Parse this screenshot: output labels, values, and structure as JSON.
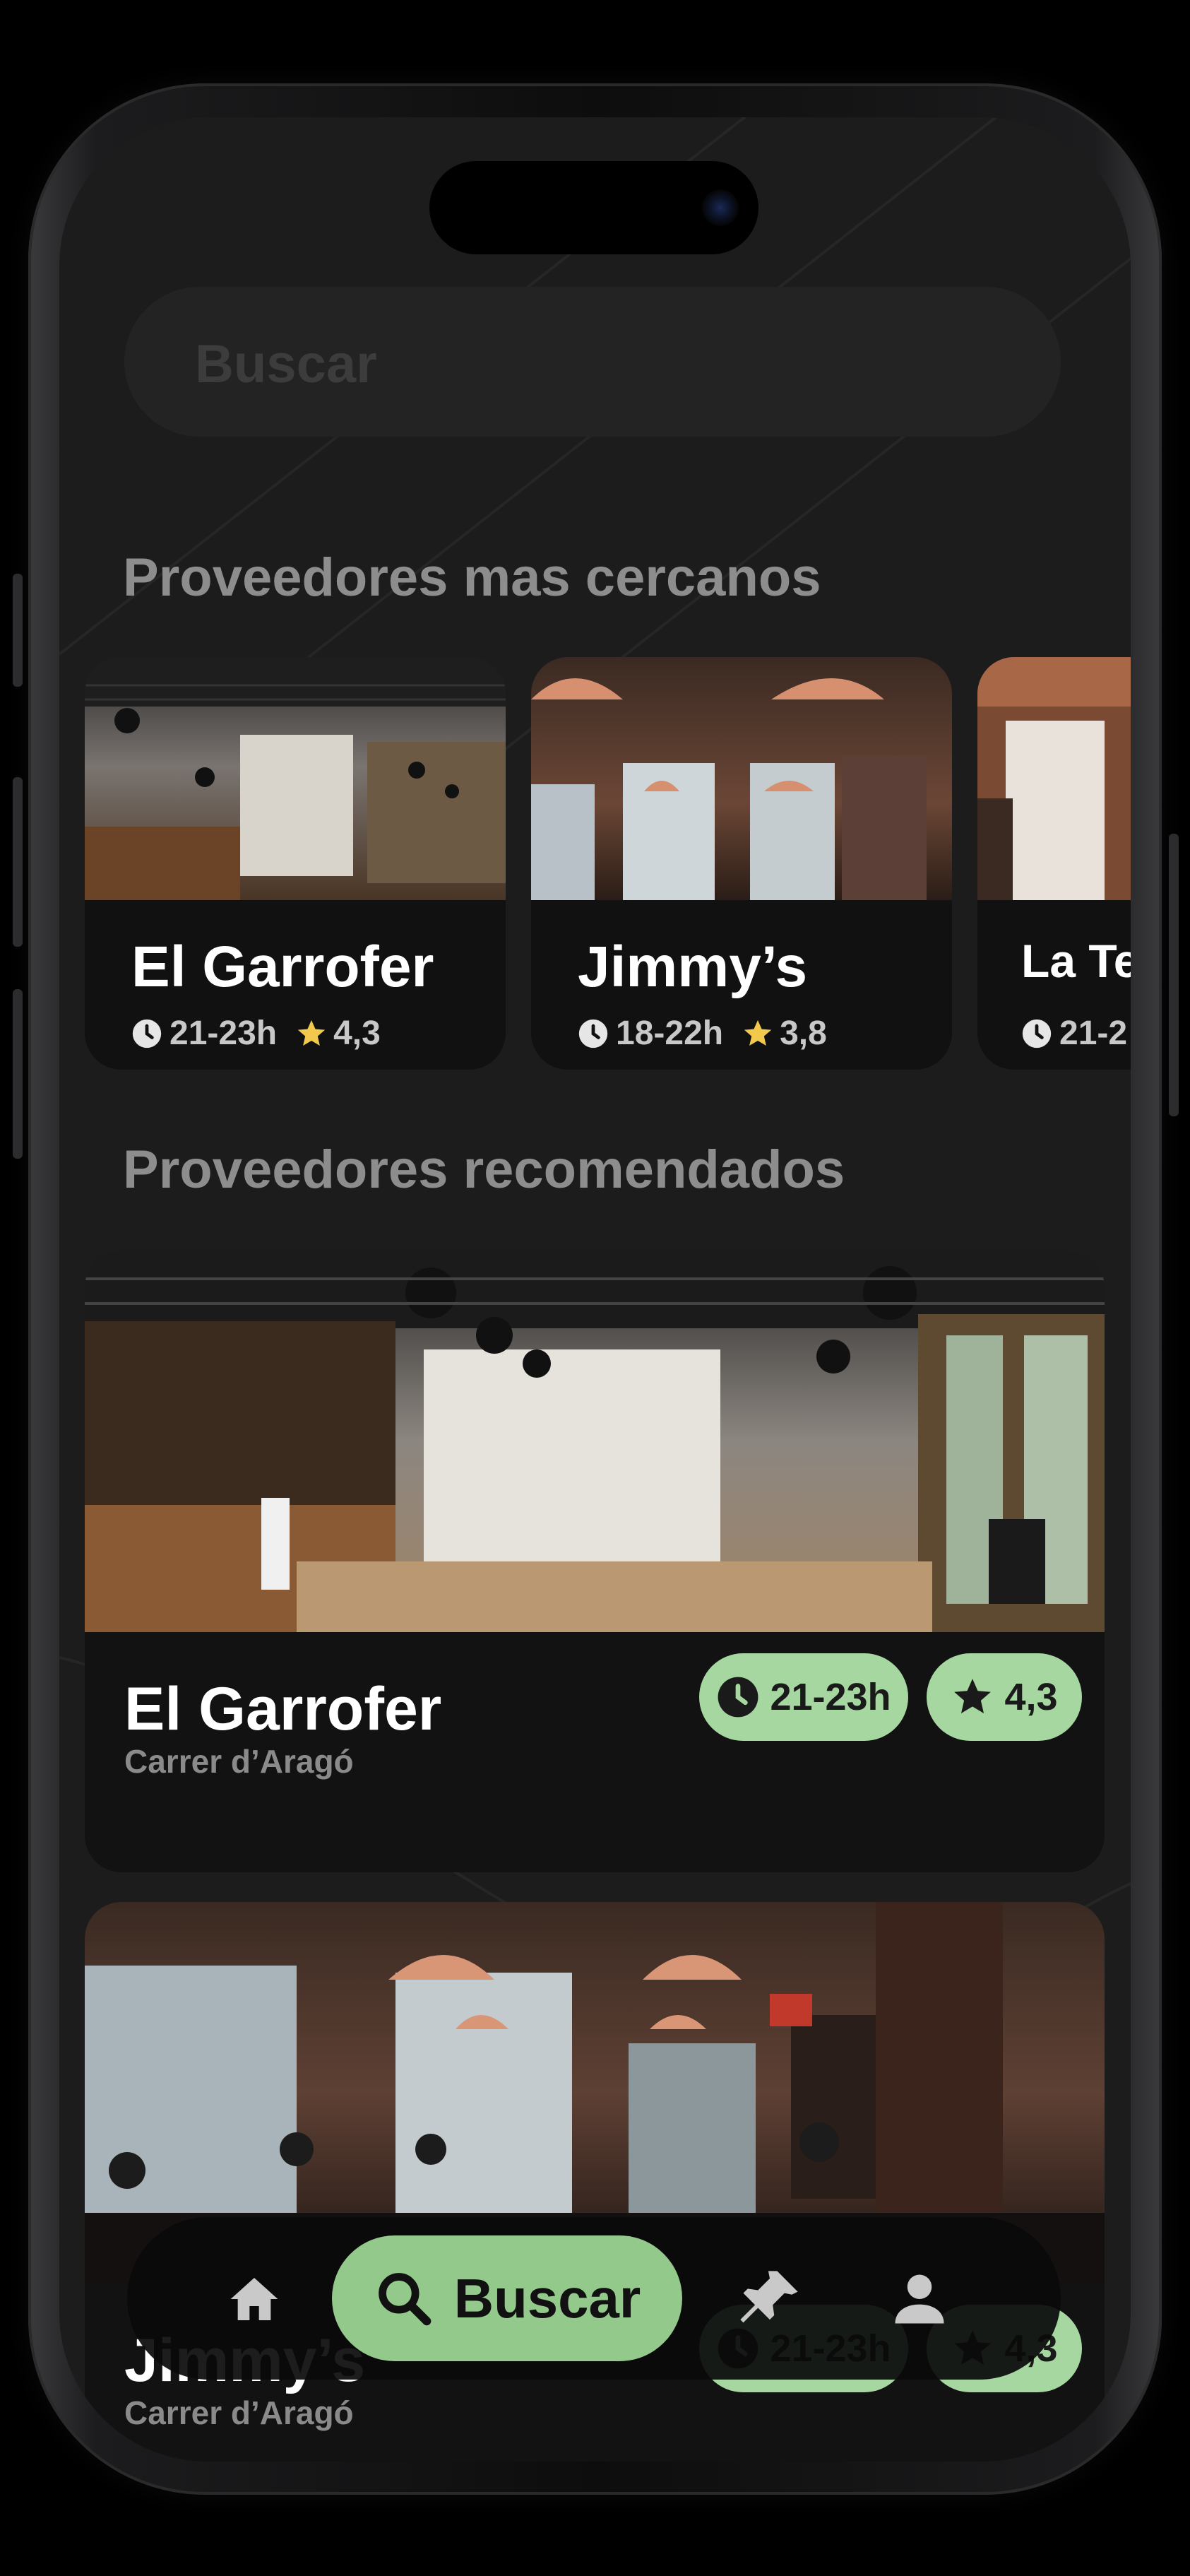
{
  "search": {
    "placeholder": "Buscar"
  },
  "sections": {
    "nearby_title": "Proveedores mas cercanos",
    "recommended_title": "Proveedores recomendados"
  },
  "nearby": [
    {
      "name": "El Garrofer",
      "hours": "21-23h",
      "rating": "4,3"
    },
    {
      "name": "Jimmy’s",
      "hours": "18-22h",
      "rating": "3,8"
    },
    {
      "name": "La Te",
      "hours": "21-2"
    }
  ],
  "recommended": [
    {
      "name": "El Garrofer",
      "address": "Carrer d’Aragó",
      "hours": "21-23h",
      "rating": "4,3"
    },
    {
      "name": "Jimmy’s",
      "address": "Carrer d’Aragó",
      "hours": "21-23h",
      "rating": "4,3"
    }
  ],
  "tabbar": {
    "home_icon": "home-icon",
    "search_label": "Buscar",
    "search_icon": "search-icon",
    "pin_icon": "pin-icon",
    "profile_icon": "user-icon"
  },
  "colors": {
    "accent": "#a6d7a0",
    "tab_active": "#94c98c",
    "rating_star": "#f2c94c",
    "background": "#1c1c1c",
    "card": "#121212"
  }
}
